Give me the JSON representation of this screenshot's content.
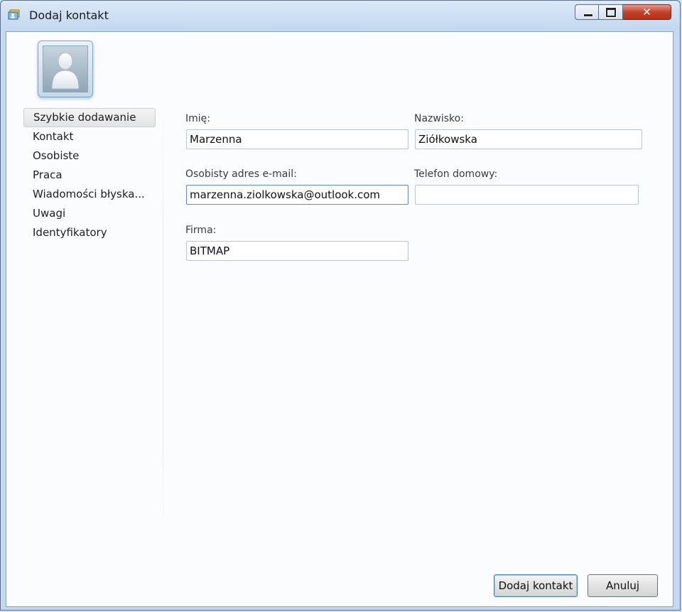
{
  "window": {
    "title": "Dodaj kontakt",
    "icons": {
      "app": "contacts-app-icon",
      "minimize": "minimize-icon",
      "maximize": "maximize-icon",
      "close": "close-icon"
    },
    "close_glyph": "✕"
  },
  "avatar": {
    "icon": "default-contact-avatar-icon"
  },
  "nav": {
    "items": [
      {
        "label": "Szybkie dodawanie",
        "selected": true
      },
      {
        "label": "Kontakt"
      },
      {
        "label": "Osobiste"
      },
      {
        "label": "Praca"
      },
      {
        "label": "Wiadomości błyska..."
      },
      {
        "label": "Uwagi"
      },
      {
        "label": "Identyfikatory"
      }
    ]
  },
  "form": {
    "first_name": {
      "label": "Imię:",
      "value": "Marzenna"
    },
    "last_name": {
      "label": "Nazwisko:",
      "value": "Ziółkowska"
    },
    "email": {
      "label": "Osobisty adres e-mail:",
      "value": "marzenna.ziolkowska@outlook.com"
    },
    "home_phone": {
      "label": "Telefon domowy:",
      "value": ""
    },
    "company": {
      "label": "Firma:",
      "value": "BITMAP"
    }
  },
  "buttons": {
    "add_label": "Dodaj kontakt",
    "cancel_label": "Anuluj"
  }
}
